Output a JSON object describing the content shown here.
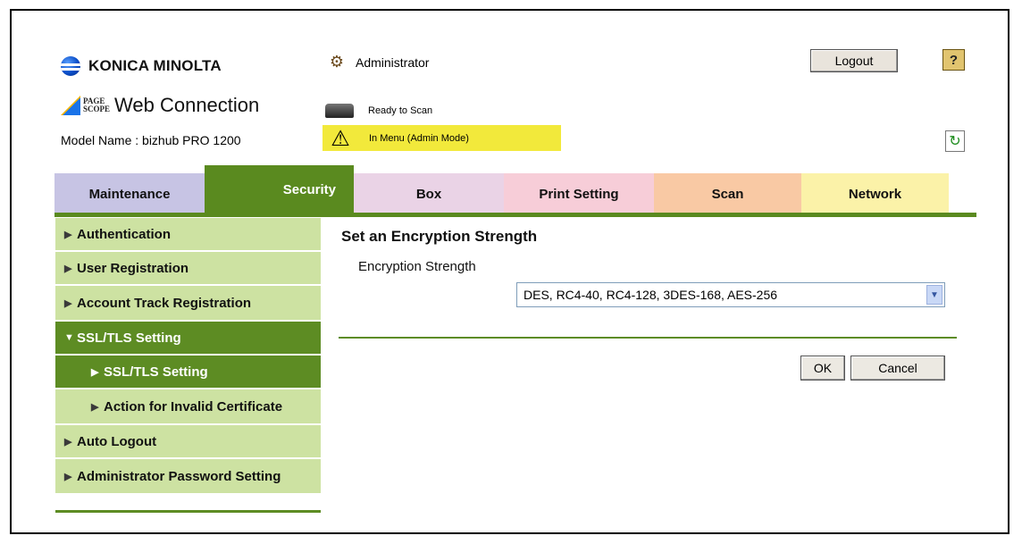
{
  "header": {
    "brand": "KONICA MINOLTA",
    "pagescope_line1": "PAGE",
    "pagescope_line2": "SCOPE",
    "product": "Web Connection",
    "model": "Model Name : bizhub PRO 1200",
    "user": "Administrator",
    "scan_status": "Ready to Scan",
    "menu_status": "In Menu (Admin Mode)",
    "logout_label": "Logout",
    "help_label": "?",
    "refresh_label": "↻"
  },
  "tabs": [
    {
      "label": "Maintenance"
    },
    {
      "label": "Security"
    },
    {
      "label": "Box"
    },
    {
      "label": "Print Setting"
    },
    {
      "label": "Scan"
    },
    {
      "label": "Network"
    }
  ],
  "sidebar": {
    "items": [
      {
        "label": "Authentication"
      },
      {
        "label": "User Registration"
      },
      {
        "label": "Account Track Registration"
      },
      {
        "label": "SSL/TLS Setting"
      },
      {
        "label": "SSL/TLS Setting"
      },
      {
        "label": "Action for Invalid Certificate"
      },
      {
        "label": "Auto Logout"
      },
      {
        "label": "Administrator Password Setting"
      }
    ]
  },
  "main": {
    "title": "Set an Encryption Strength",
    "field_label": "Encryption Strength",
    "select_value": "DES, RC4-40, RC4-128, 3DES-168, AES-256",
    "ok_label": "OK",
    "cancel_label": "Cancel"
  },
  "colors": {
    "security_green": "#5a8a1f",
    "sidebar_light": "#cde2a2",
    "warning_yellow": "#f2e93b"
  }
}
